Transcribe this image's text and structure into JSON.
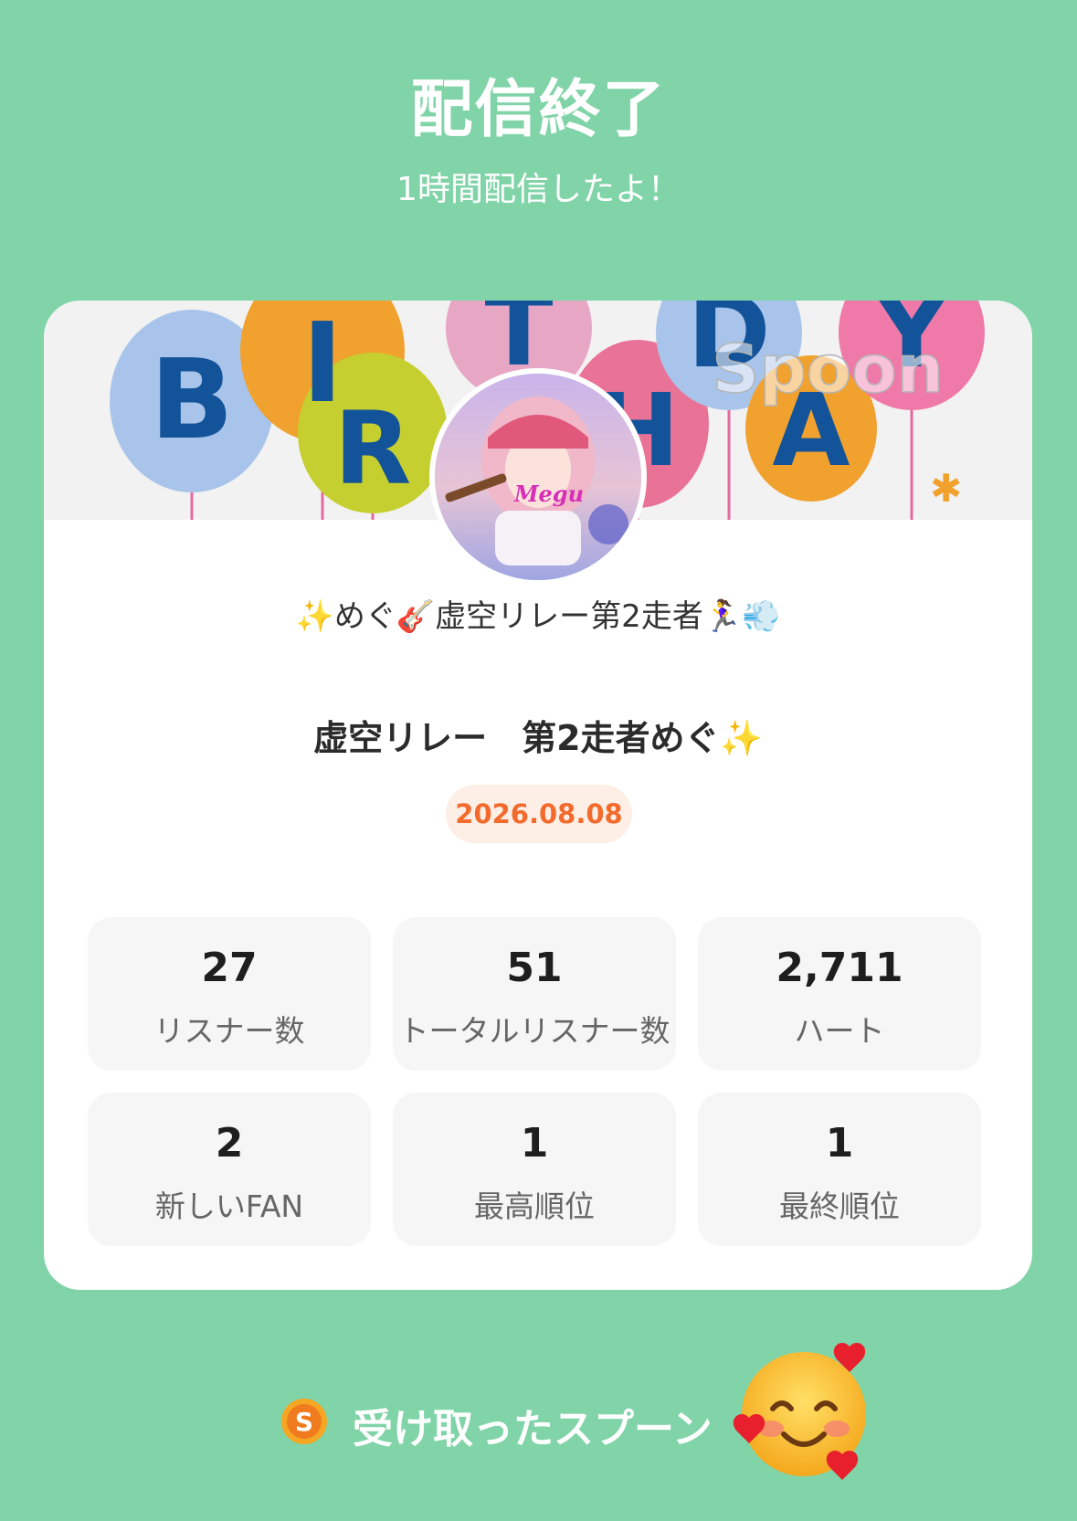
{
  "header": {
    "title": "配信終了",
    "subtitle": "1時間配信したよ！"
  },
  "banner": {
    "letters": [
      "B",
      "I",
      "R",
      "T",
      "H",
      "D",
      "A",
      "Y"
    ],
    "watermark": "Spoon"
  },
  "avatar": {
    "overlay_text": "Megu"
  },
  "card": {
    "host_name": "✨めぐ🎸虚空リレー第2走者🏃‍♀️💨",
    "live_title": "虚空リレー　第2走者めぐ✨",
    "date": "2026.08.08"
  },
  "stats": [
    {
      "value": "27",
      "label": "リスナー数"
    },
    {
      "value": "51",
      "label": "トータルリスナー数"
    },
    {
      "value": "2,711",
      "label": "ハート"
    },
    {
      "value": "2",
      "label": "新しいFAN"
    },
    {
      "value": "1",
      "label": "最高順位"
    },
    {
      "value": "1",
      "label": "最終順位"
    }
  ],
  "footer": {
    "coin_icon": "spoon-coin-icon",
    "label": "受け取ったスプーン",
    "emoji": "smiling-face-with-hearts"
  },
  "colors": {
    "background": "#80d4a8",
    "date_text": "#f26b2d",
    "date_bg": "#fdeee6",
    "stat_bg": "#f6f6f6"
  }
}
